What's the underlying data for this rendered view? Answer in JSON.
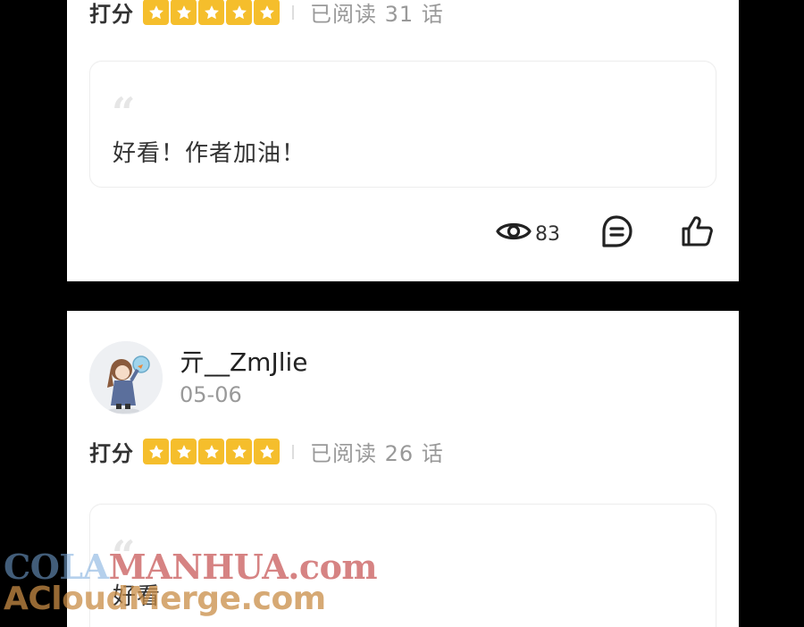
{
  "review_1": {
    "rating_label": "打分",
    "stars": 5,
    "read_text": "已阅读 31 话",
    "comment": "好看！作者加油！",
    "views": "83"
  },
  "review_2": {
    "username": "亓__ZmJlie",
    "date": "05-06",
    "rating_label": "打分",
    "stars": 5,
    "read_text": "已阅读 26 话",
    "comment": "好看"
  },
  "watermark": {
    "line1_a": "COLA",
    "line1_b": "MANHUA.com",
    "line2": "ACloudMerge.com"
  },
  "colors": {
    "star_bg": "#F5BE2C",
    "page_bg": "#000000",
    "card_bg": "#FFFFFF"
  },
  "icons": {
    "quote": "open-quote-icon",
    "view": "eye-icon",
    "comment": "comment-bubble-icon",
    "like": "thumbs-up-icon"
  }
}
